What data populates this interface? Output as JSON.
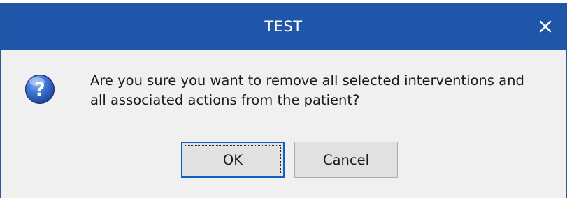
{
  "dialog": {
    "title": "TEST",
    "message_line1": "Are you sure you want to remove all selected interventions and",
    "message_line2": "all associated actions from the patient?",
    "icon": "question-icon",
    "ok_label": "OK",
    "cancel_label": "Cancel"
  },
  "colors": {
    "titlebar": "#1f56aa",
    "title_text": "#ffffff",
    "body_background": "#f0f0f0",
    "default_button_border": "#0f5fc2"
  }
}
